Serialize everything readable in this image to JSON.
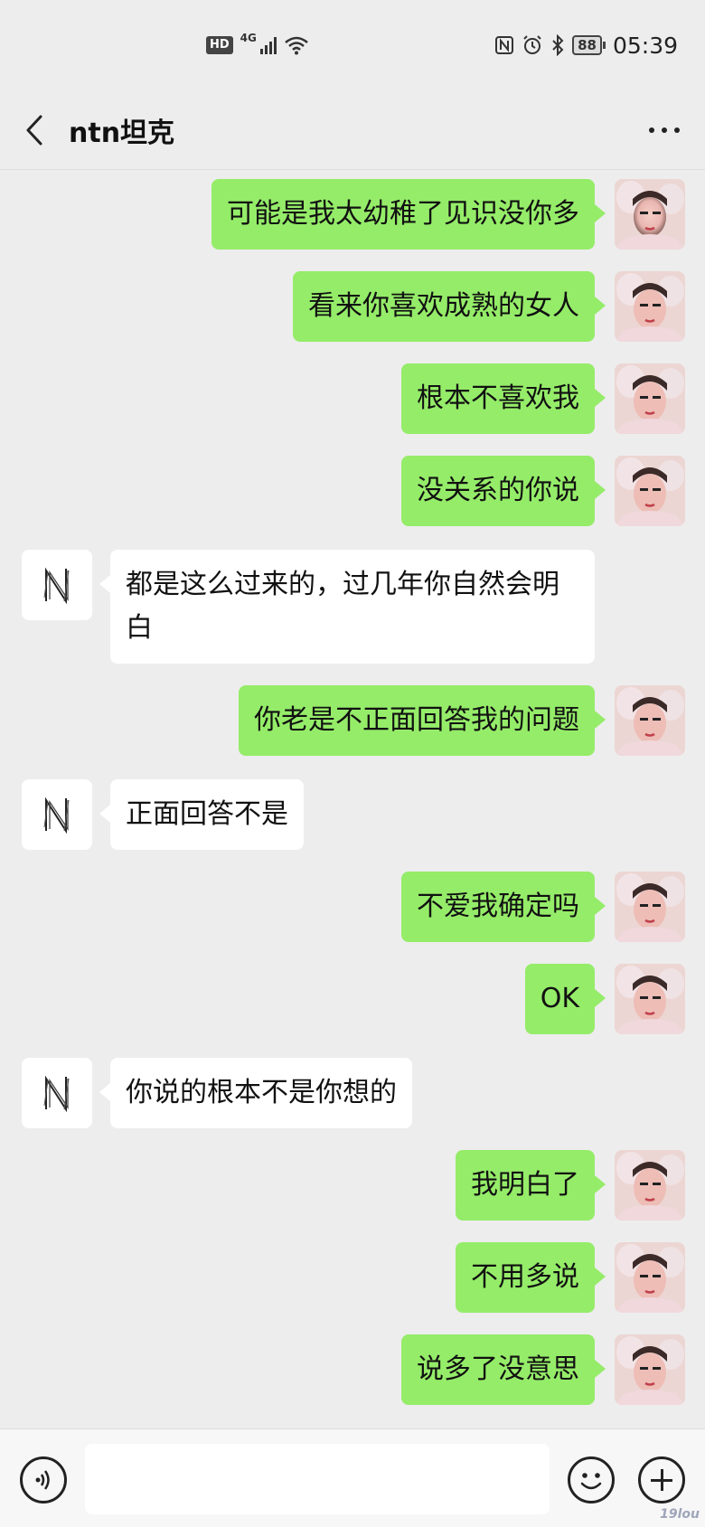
{
  "status_bar": {
    "hd": "HD",
    "network": "4G",
    "battery": "88",
    "time": "05:39",
    "icons": [
      "nfc-icon",
      "alarm-icon",
      "bluetooth-icon"
    ]
  },
  "header": {
    "back_icon": "chevron-left-icon",
    "title": "ntn坦克",
    "more_icon": "more-dots-icon"
  },
  "messages": [
    {
      "sender": "me",
      "text": "可能是我太幼稚了见识没你多"
    },
    {
      "sender": "me",
      "text": "看来你喜欢成熟的女人"
    },
    {
      "sender": "me",
      "text": "根本不喜欢我"
    },
    {
      "sender": "me",
      "text": "没关系的你说"
    },
    {
      "sender": "them",
      "text": "都是这么过来的，过几年你自然会明白"
    },
    {
      "sender": "me",
      "text": "你老是不正面回答我的问题"
    },
    {
      "sender": "them",
      "text": "正面回答不是"
    },
    {
      "sender": "me",
      "text": "不爱我确定吗"
    },
    {
      "sender": "me",
      "text": "OK"
    },
    {
      "sender": "them",
      "text": "你说的根本不是你想的"
    },
    {
      "sender": "me",
      "text": "我明白了"
    },
    {
      "sender": "me",
      "text": "不用多说"
    },
    {
      "sender": "me",
      "text": "说多了没意思"
    }
  ],
  "input_bar": {
    "voice_icon": "voice-icon",
    "emoji_icon": "emoji-icon",
    "plus_icon": "plus-icon",
    "watermark": "19lou"
  },
  "colors": {
    "background": "#ededed",
    "my_bubble": "#95ec69",
    "their_bubble": "#ffffff"
  }
}
